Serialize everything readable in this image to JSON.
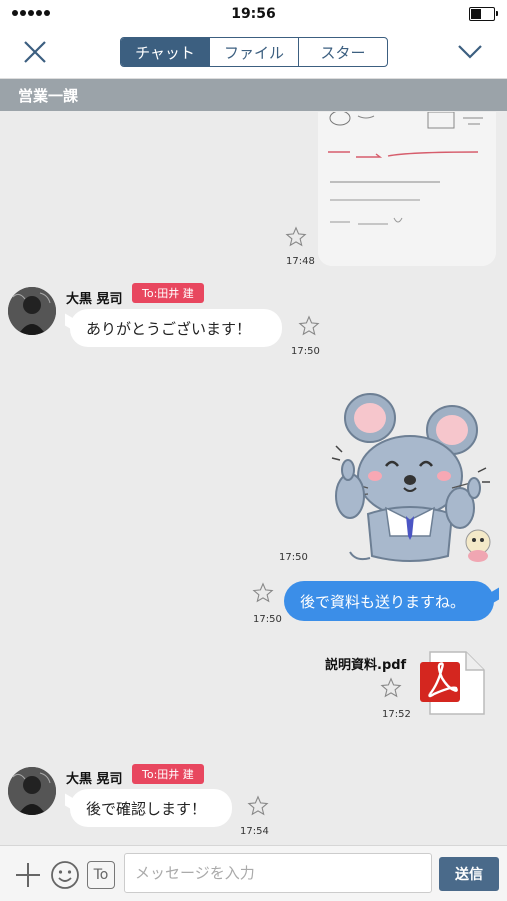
{
  "status_bar": {
    "time": "19:56"
  },
  "nav": {
    "tabs": [
      {
        "label": "チャット",
        "active": true
      },
      {
        "label": "ファイル",
        "active": false
      },
      {
        "label": "スター",
        "active": false
      }
    ]
  },
  "room": {
    "name": "営業一課"
  },
  "messages": [
    {
      "type": "photo",
      "time": "17:48",
      "photo_text": [
        "課長 → 高松先生 説明会 5/20",
        "・ブリーフィング資料",
        "・資料チェック"
      ]
    },
    {
      "type": "text",
      "sender": "大黒 晃司",
      "to": "To:田井 建",
      "text": "ありがとうございます！",
      "time": "17:50"
    },
    {
      "type": "sticker",
      "time": "17:50",
      "sticker": "mouse-thumbs-up-sticker"
    },
    {
      "type": "text_out",
      "text": "後で資料も送りますね。",
      "time": "17:50"
    },
    {
      "type": "file",
      "filename": "説明資料.pdf",
      "time": "17:52",
      "icon": "pdf-icon"
    },
    {
      "type": "text",
      "sender": "大黒 晃司",
      "to": "To:田井 建",
      "text": "後で確認します！",
      "time": "17:54"
    }
  ],
  "input": {
    "placeholder": "メッセージを入力",
    "value": "",
    "send_label": "送信",
    "to_label": "To"
  },
  "colors": {
    "accent": "#3c5f80",
    "bubble_out": "#3b8ee8",
    "to_badge": "#e8475f",
    "room_bar": "#9ba3a9"
  }
}
